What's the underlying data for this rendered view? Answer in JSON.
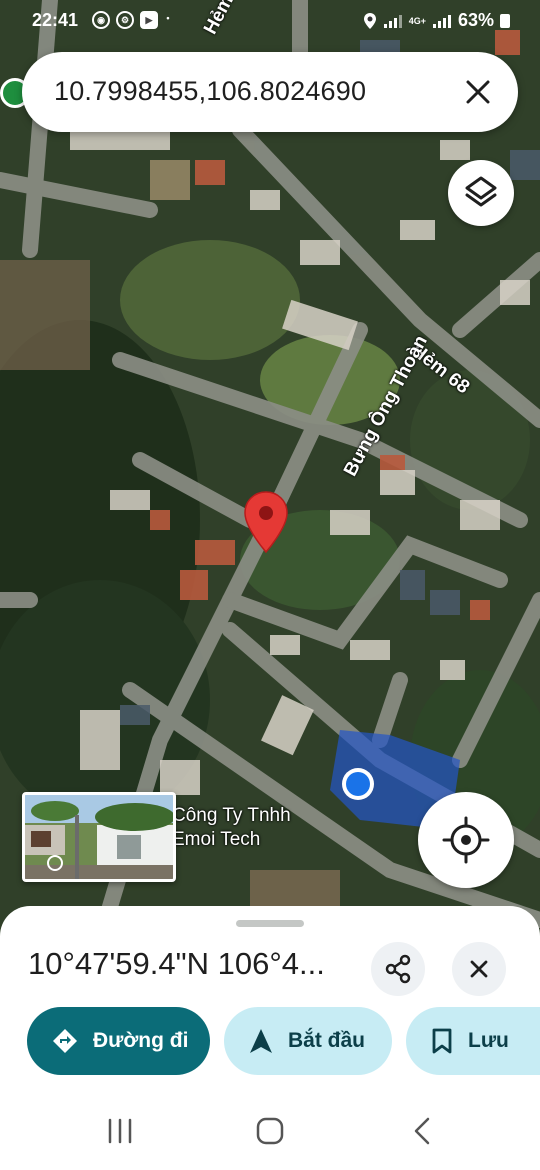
{
  "status_bar": {
    "time": "22:41",
    "network": "4G+",
    "battery": "63%"
  },
  "search": {
    "query": "10.7998455,106.8024690"
  },
  "map": {
    "streets": [
      "Hẻm 68",
      "Bưng Ông Thoàn",
      "Hẻm"
    ],
    "place_label_line1": "Công Ty Tnhh",
    "place_label_line2": "Emoi Tech",
    "pin_color": "#e53935",
    "location_dot_color": "#1a73e8"
  },
  "place_sheet": {
    "title": "10°47'59.4\"N 106°4...",
    "directions_label": "Đường đi",
    "start_label": "Bắt đầu",
    "save_label": "Lưu"
  },
  "colors": {
    "primary_teal": "#0b6c78",
    "tonal_button": "#c7ecf4"
  },
  "icons": [
    "close-icon",
    "layers-icon",
    "my-location-icon",
    "share-icon",
    "directions-icon",
    "navigation-arrow-icon",
    "bookmark-icon",
    "recents-icon",
    "home-icon",
    "back-icon"
  ]
}
